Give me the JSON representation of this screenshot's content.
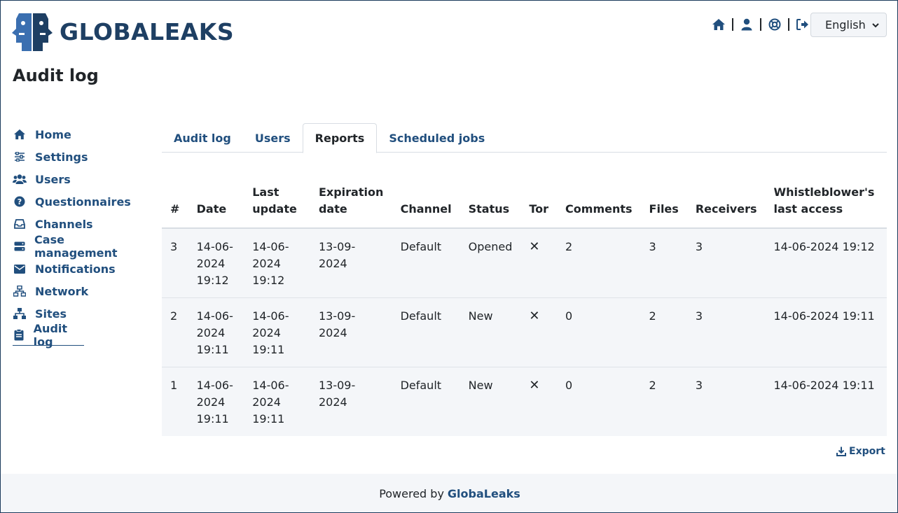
{
  "brand": {
    "name": "GLOBALEAKS"
  },
  "header": {
    "icons": [
      "home-icon",
      "user-icon",
      "lifebuoy-icon",
      "logout-icon"
    ],
    "language": "English"
  },
  "page": {
    "title": "Audit log"
  },
  "sidebar": {
    "items": [
      {
        "label": "Home",
        "icon": "home-icon"
      },
      {
        "label": "Settings",
        "icon": "sliders-icon"
      },
      {
        "label": "Users",
        "icon": "users-icon"
      },
      {
        "label": "Questionnaires",
        "icon": "question-circle-icon"
      },
      {
        "label": "Channels",
        "icon": "inbox-icon"
      },
      {
        "label": "Case management",
        "icon": "server-icon"
      },
      {
        "label": "Notifications",
        "icon": "envelope-icon"
      },
      {
        "label": "Network",
        "icon": "network-icon"
      },
      {
        "label": "Sites",
        "icon": "sitemap-icon"
      },
      {
        "label": "Audit log",
        "icon": "clipboard-icon"
      }
    ],
    "active": "Audit log"
  },
  "tabs": {
    "items": [
      "Audit log",
      "Users",
      "Reports",
      "Scheduled jobs"
    ],
    "active": "Reports"
  },
  "table": {
    "headers": {
      "num": "#",
      "date": "Date",
      "last_update": "Last update",
      "expiration": "Expiration date",
      "channel": "Channel",
      "status": "Status",
      "tor": "Tor",
      "comments": "Comments",
      "files": "Files",
      "receivers": "Receivers",
      "wb_access": "Whistleblower's last access"
    },
    "rows": [
      {
        "num": "3",
        "date": "14-06-2024 19:12",
        "last_update": "14-06-2024 19:12",
        "expiration": "13-09-2024",
        "channel": "Default",
        "status": "Opened",
        "tor": "✕",
        "comments": "2",
        "files": "3",
        "receivers": "3",
        "wb_access": "14-06-2024 19:12"
      },
      {
        "num": "2",
        "date": "14-06-2024 19:11",
        "last_update": "14-06-2024 19:11",
        "expiration": "13-09-2024",
        "channel": "Default",
        "status": "New",
        "tor": "✕",
        "comments": "0",
        "files": "2",
        "receivers": "3",
        "wb_access": "14-06-2024 19:11"
      },
      {
        "num": "1",
        "date": "14-06-2024 19:11",
        "last_update": "14-06-2024 19:11",
        "expiration": "13-09-2024",
        "channel": "Default",
        "status": "New",
        "tor": "✕",
        "comments": "0",
        "files": "2",
        "receivers": "3",
        "wb_access": "14-06-2024 19:11"
      }
    ]
  },
  "export": {
    "label": "Export"
  },
  "footer": {
    "prefix": "Powered by",
    "link": "GlobaLeaks"
  },
  "colors": {
    "brand": "#214f7e",
    "logo_dark": "#1e3f63",
    "logo_light": "#3b6fb0",
    "row_bg": "#f4f6f9"
  }
}
